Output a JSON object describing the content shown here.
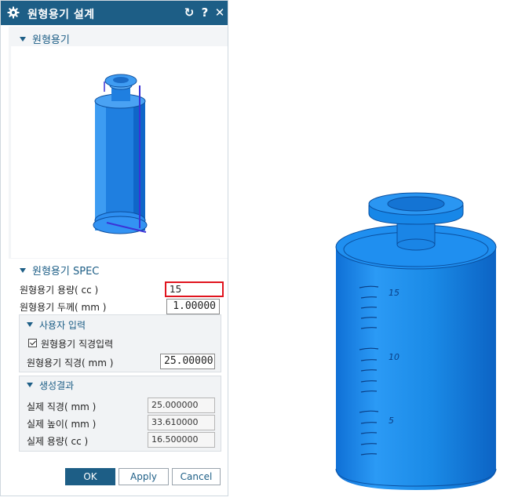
{
  "dialog": {
    "title": "원형용기 설계",
    "icons": {
      "gear": "gear-icon",
      "reset": "reset-icon",
      "help": "help-icon",
      "close": "close-icon"
    },
    "help_label": "?",
    "close_label": "✕",
    "reset_label": "↻"
  },
  "section_preview": {
    "label": "원형용기"
  },
  "section_spec": {
    "label": "원형용기 SPEC",
    "capacity_label": "원형용기 용량( cc )",
    "capacity_value": "15",
    "thickness_label": "원형용기 두께( mm )",
    "thickness_value": "1.00000"
  },
  "user_input": {
    "label": "사용자 입력",
    "direct_checkbox_label": "원형용기 직경입력",
    "direct_checked": true,
    "diameter_label": "원형용기 직경( mm )",
    "diameter_value": "25.00000"
  },
  "results": {
    "label": "생성결과",
    "rows": [
      {
        "label": "실제 직경( mm )",
        "value": "25.000000"
      },
      {
        "label": "실제 높이( mm )",
        "value": "33.610000"
      },
      {
        "label": "실제 용량( cc )",
        "value": "16.500000"
      }
    ]
  },
  "buttons": {
    "ok": "OK",
    "apply": "Apply",
    "cancel": "Cancel"
  },
  "scale_marks": {
    "top": "15",
    "mid": "10",
    "low": "5"
  },
  "colors": {
    "accent": "#1d5e86",
    "body": "#1a8ae6",
    "highlight": "#e0141e"
  }
}
